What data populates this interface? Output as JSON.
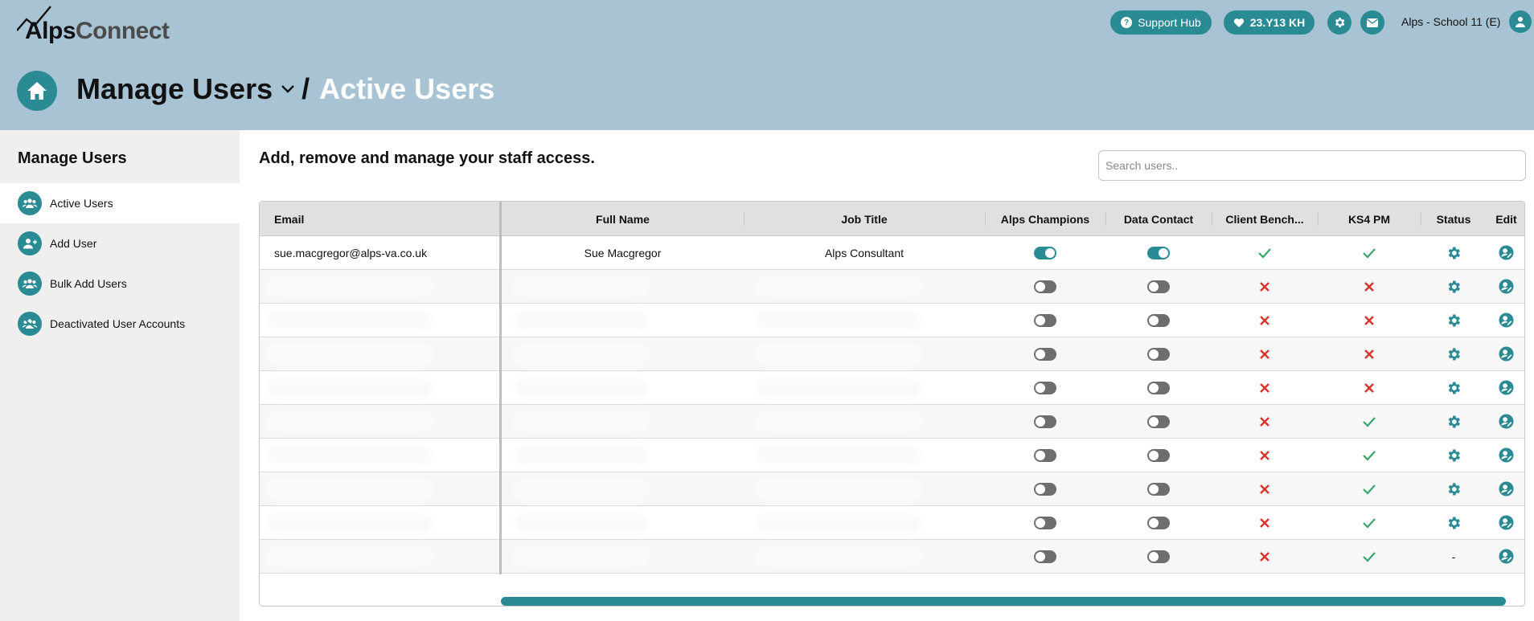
{
  "brand": {
    "part1": "Alps",
    "part2": "Connect"
  },
  "topbar": {
    "support_label": "Support Hub",
    "cohort_label": "23.Y13 KH",
    "school_label": "Alps - School 11 (E)"
  },
  "breadcrumb": {
    "section": "Manage Users",
    "separator": "/",
    "current": "Active Users"
  },
  "sidebar": {
    "title": "Manage Users",
    "items": [
      {
        "label": "Active Users",
        "icon": "users-icon"
      },
      {
        "label": "Add User",
        "icon": "add-user-icon"
      },
      {
        "label": "Bulk Add Users",
        "icon": "users-plus-icon"
      },
      {
        "label": "Deactivated User Accounts",
        "icon": "users-x-icon"
      }
    ]
  },
  "main": {
    "heading": "Add, remove and manage your staff access.",
    "search_placeholder": "Search users.."
  },
  "table": {
    "columns": [
      "Email",
      "Full Name",
      "Job Title",
      "Alps Champions",
      "Data Contact",
      "Client Bench...",
      "KS4 PM",
      "Status",
      "Edit"
    ],
    "rows": [
      {
        "email": "sue.macgregor@alps-va.co.uk",
        "name": "Sue Macgregor",
        "job": "Alps Consultant",
        "champion": true,
        "contact": true,
        "bench": true,
        "ks4": true,
        "status": "gear"
      },
      {
        "email": "",
        "name": "",
        "job": "",
        "champion": false,
        "contact": false,
        "bench": false,
        "ks4": false,
        "status": "gear"
      },
      {
        "email": "",
        "name": "",
        "job": "",
        "champion": false,
        "contact": false,
        "bench": false,
        "ks4": false,
        "status": "gear"
      },
      {
        "email": "",
        "name": "",
        "job": "",
        "champion": false,
        "contact": false,
        "bench": false,
        "ks4": false,
        "status": "gear"
      },
      {
        "email": "",
        "name": "",
        "job": "",
        "champion": false,
        "contact": false,
        "bench": false,
        "ks4": false,
        "status": "gear"
      },
      {
        "email": "",
        "name": "",
        "job": "",
        "champion": false,
        "contact": false,
        "bench": false,
        "ks4": true,
        "status": "gear"
      },
      {
        "email": "",
        "name": "",
        "job": "",
        "champion": false,
        "contact": false,
        "bench": false,
        "ks4": true,
        "status": "gear"
      },
      {
        "email": "",
        "name": "",
        "job": "",
        "champion": false,
        "contact": false,
        "bench": false,
        "ks4": true,
        "status": "gear"
      },
      {
        "email": "",
        "name": "",
        "job": "",
        "champion": false,
        "contact": false,
        "bench": false,
        "ks4": true,
        "status": "gear"
      },
      {
        "email": "",
        "name": "",
        "job": "",
        "champion": false,
        "contact": false,
        "bench": false,
        "ks4": true,
        "status": "-"
      }
    ]
  },
  "colors": {
    "accent": "#2b8b94",
    "header_bg": "#a8c4d4",
    "check": "#3aa66a",
    "cross": "#d9342b"
  }
}
